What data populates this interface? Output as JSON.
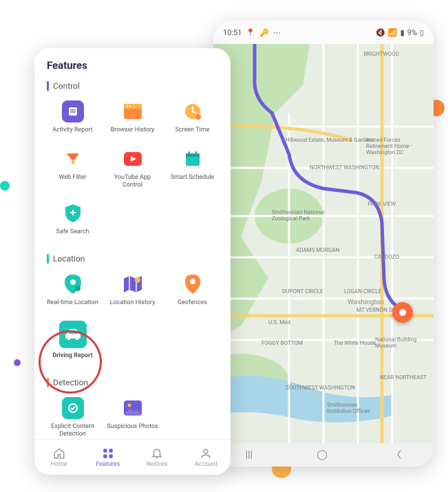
{
  "status": {
    "time": "10:51",
    "battery": "9%"
  },
  "map": {
    "labels": [
      "BRIGHTWOOD",
      "Hillwood Estate, Museum & Gardens",
      "Armed Forces Retirement Home–Washington DC",
      "NORTHWEST WASHINGTON",
      "PARK VIEW",
      "Smithsonian National Zoological Park",
      "ADAMS MORGAN",
      "CARDOZO",
      "DUPONT CIRCLE",
      "LOGAN CIRCLE",
      "Washington",
      "MT VERNON SQUARE",
      "U.S. Mint",
      "FOGGY BOTTOM",
      "The White House",
      "National Building Museum",
      "SOUTHWEST WASHINGTON",
      "Smithsonian Institution Offices",
      "NEAR NORTHEAST"
    ]
  },
  "app": {
    "title": "Features",
    "sections": {
      "control": {
        "title": "Control",
        "items": [
          {
            "label": "Activity Report"
          },
          {
            "label": "Browser History"
          },
          {
            "label": "Screen Time"
          },
          {
            "label": "Web Filter"
          },
          {
            "label": "YouTube App Control"
          },
          {
            "label": "Smart Schedule"
          },
          {
            "label": "Safe Search"
          }
        ]
      },
      "location": {
        "title": "Location",
        "items": [
          {
            "label": "Real-time Location"
          },
          {
            "label": "Location History"
          },
          {
            "label": "Geofences"
          },
          {
            "label": "Driving Report"
          }
        ]
      },
      "detection": {
        "title": "Detection",
        "items": [
          {
            "label": "Explicit Content Detection"
          },
          {
            "label": "Suspicious Photos"
          }
        ]
      }
    },
    "nav": {
      "home": "Home",
      "features": "Features",
      "notices": "Notices",
      "account": "Account"
    }
  }
}
